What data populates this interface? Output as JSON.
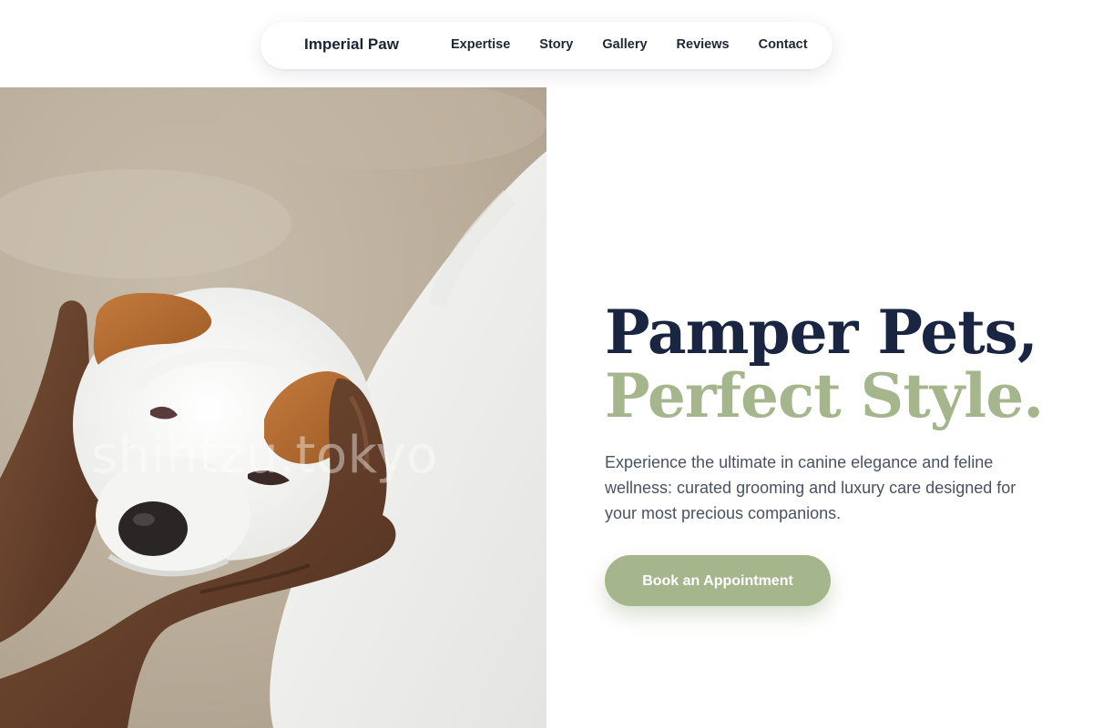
{
  "nav": {
    "brand": "Imperial Paw",
    "links": [
      "Expertise",
      "Story",
      "Gallery",
      "Reviews",
      "Contact"
    ]
  },
  "hero": {
    "image_alt": "Puppy held by two hands",
    "watermark": "shihtzu.tokyo",
    "headline_line1": "Pamper Pets,",
    "headline_line2": "Perfect Style.",
    "subtitle": "Experience the ultimate in canine elegance and feline wellness: curated grooming and luxury care designed for your most precious companions.",
    "cta_label": "Book an Appointment"
  },
  "colors": {
    "navy": "#1a2541",
    "sage": "#a5b58c",
    "body_text": "#4a5260",
    "background": "#ffffff"
  }
}
